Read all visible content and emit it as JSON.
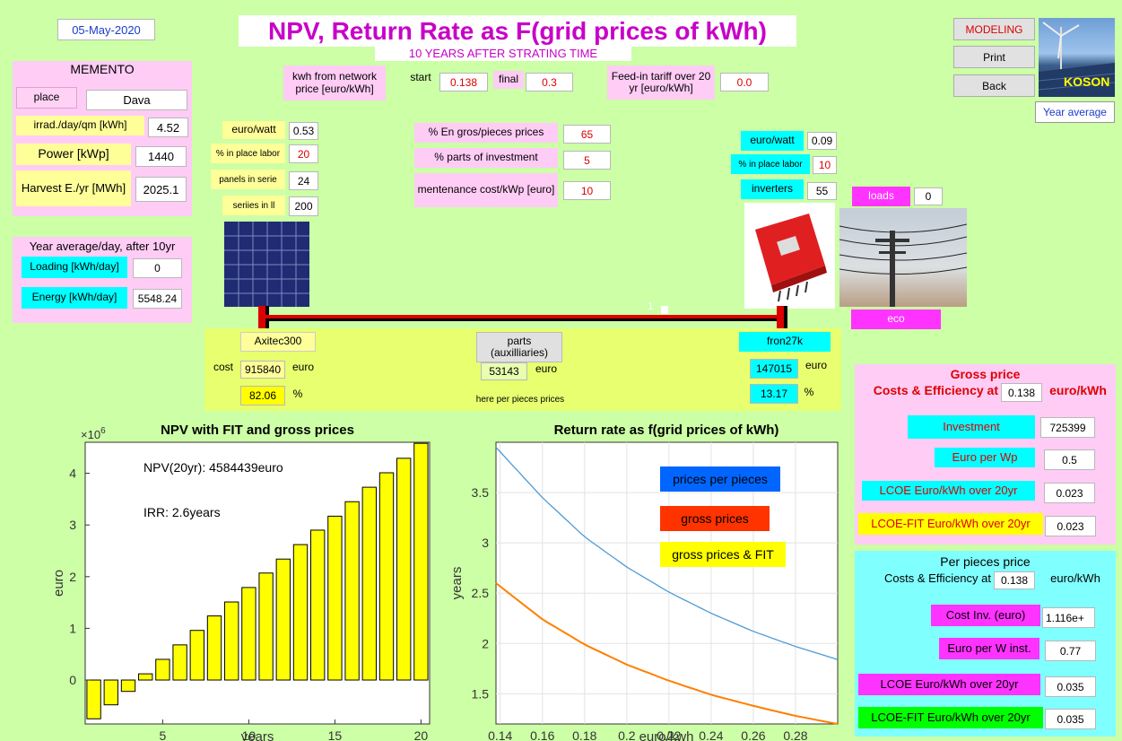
{
  "header": {
    "date": "05-May-2020",
    "title": "NPV, Return Rate as F(grid prices of kWh)",
    "subtitle": "10 YEARS AFTER STRATING TIME"
  },
  "buttons": {
    "modeling": "MODELING",
    "print": "Print",
    "back": "Back",
    "year_average": "Year average"
  },
  "brand": "KOSON",
  "memento": {
    "title": "MEMENTO",
    "place_label": "place",
    "place_value": "Dava",
    "irrad_label": "irrad./day/qm  [kWh]",
    "irrad_value": "4.52",
    "power_label": "Power  [kWp]",
    "power_value": "1440",
    "harvest_label": "Harvest E./yr [MWh]",
    "harvest_value": "2025.1"
  },
  "year_avg": {
    "title": "Year average/day,  after 10yr",
    "loading_label": "Loading  [kWh/day]",
    "loading_value": "0",
    "energy_label": "Energy  [kWh/day]",
    "energy_value": "5548.24"
  },
  "network": {
    "price_label": "kwh from network price  [euro/kWh]",
    "start_label": "start",
    "start_value": "0.138",
    "final_label": "final",
    "final_value": "0.3",
    "fit_label": "Feed-in tariff over 20 yr  [euro/kWh]",
    "fit_value": "0.0"
  },
  "panels": {
    "euro_watt_label": "euro/watt",
    "euro_watt_value": "0.53",
    "labor_label": "% in place labor",
    "labor_value": "20",
    "serie_label": "panels in serie",
    "serie_value": "24",
    "parallel_label": "seriies in ll",
    "parallel_value": "200",
    "model": "Axitec300",
    "cost_label": "cost",
    "cost_value": "915840",
    "cost_unit": "euro",
    "percent_value": "82.06",
    "percent_unit": "%"
  },
  "middle": {
    "engros_label": "% En gros/pieces prices",
    "engros_value": "65",
    "parts_label": "% parts of investment",
    "parts_value": "5",
    "maint_label": "mentenance cost/kWp [euro]",
    "maint_value": "10",
    "aux_label": "parts (auxilliaries)",
    "aux_value": "53143",
    "aux_unit": "euro",
    "note": "here per pieces prices"
  },
  "inverter": {
    "euro_watt_label": "euro/watt",
    "euro_watt_value": "0.09",
    "labor_label": "% in place labor",
    "labor_value": "10",
    "count_label": "inverters",
    "count_value": "55",
    "model": "fron27k",
    "cost_value": "147015",
    "cost_unit": "euro",
    "percent_value": "13.17",
    "percent_unit": "%"
  },
  "loads": {
    "label": "loads",
    "value": "0",
    "eco": "eco"
  },
  "wire_label": "1",
  "gross": {
    "title": "Gross price",
    "costs_label": "Costs & Efficiency at",
    "price_value": "0.138",
    "unit": "euro/kWh",
    "investment_label": "Investment",
    "investment_value": "725399",
    "euro_wp_label": "Euro per Wp",
    "euro_wp_value": "0.5",
    "lcoe_label": "LCOE Euro/kWh over 20yr",
    "lcoe_value": "0.023",
    "lcoefit_label": "LCOE-FIT  Euro/kWh over 20yr",
    "lcoefit_value": "0.023"
  },
  "pieces": {
    "title": "Per pieces price",
    "costs_label": "Costs & Efficiency at",
    "price_value": "0.138",
    "unit": "euro/kWh",
    "inv_label": "Cost Inv. (euro)",
    "inv_value": "1.116e+",
    "euro_w_label": "Euro per W inst.",
    "euro_w_value": "0.77",
    "lcoe_label": "LCOE Euro/kWh over 20yr",
    "lcoe_value": "0.035",
    "lcoefit_label": "LCOE-FIT  Euro/kWh over 20yr",
    "lcoefit_value": "0.035"
  },
  "colors": {
    "bar": "#ffff00",
    "blue_curve": "#4d9bd6",
    "orange_curve": "#ff7f00",
    "legend_blue": "#0066ff",
    "legend_red": "#ff3300",
    "legend_yellow": "#ffff00"
  },
  "chart_data": [
    {
      "type": "bar",
      "title": "NPV with FIT and gross prices",
      "xlabel": "years",
      "ylabel": "euro",
      "yexponent": "×10^6",
      "x": [
        1,
        2,
        3,
        4,
        5,
        6,
        7,
        8,
        9,
        10,
        11,
        12,
        13,
        14,
        15,
        16,
        17,
        18,
        19,
        20
      ],
      "values": [
        -0.75,
        -0.48,
        -0.22,
        0.12,
        0.4,
        0.68,
        0.96,
        1.24,
        1.51,
        1.79,
        2.07,
        2.34,
        2.62,
        2.9,
        3.17,
        3.45,
        3.73,
        4.01,
        4.29,
        4.58
      ],
      "xticks": [
        5,
        10,
        15,
        20
      ],
      "yticks": [
        0,
        1,
        2,
        3,
        4
      ],
      "xlim": [
        0.5,
        20.5
      ],
      "ylim": [
        -0.85,
        4.6
      ],
      "annotations": [
        "NPV(20yr): 4584439euro",
        "IRR: 2.6years"
      ]
    },
    {
      "type": "line",
      "title": "Return rate as f(grid prices of kWh)",
      "xlabel": "euro/kwh",
      "ylabel": "years",
      "xlim": [
        0.138,
        0.3
      ],
      "ylim": [
        1.2,
        4.0
      ],
      "xticks": [
        0.14,
        0.16,
        0.18,
        0.2,
        0.22,
        0.24,
        0.26,
        0.28
      ],
      "yticks": [
        1.5,
        2,
        2.5,
        3,
        3.5
      ],
      "grid": true,
      "series": [
        {
          "name": "prices per pieces",
          "x": [
            0.138,
            0.16,
            0.18,
            0.2,
            0.22,
            0.24,
            0.26,
            0.28,
            0.3
          ],
          "values": [
            3.95,
            3.45,
            3.06,
            2.76,
            2.51,
            2.3,
            2.12,
            1.97,
            1.84
          ]
        },
        {
          "name": "gross  prices",
          "x": [
            0.138,
            0.16,
            0.18,
            0.2,
            0.22,
            0.24,
            0.26,
            0.28,
            0.3
          ],
          "values": [
            2.6,
            2.24,
            1.99,
            1.79,
            1.63,
            1.49,
            1.38,
            1.28,
            1.2
          ]
        }
      ],
      "legend": [
        "prices per pieces",
        "gross  prices",
        "gross prices & FIT"
      ]
    }
  ]
}
